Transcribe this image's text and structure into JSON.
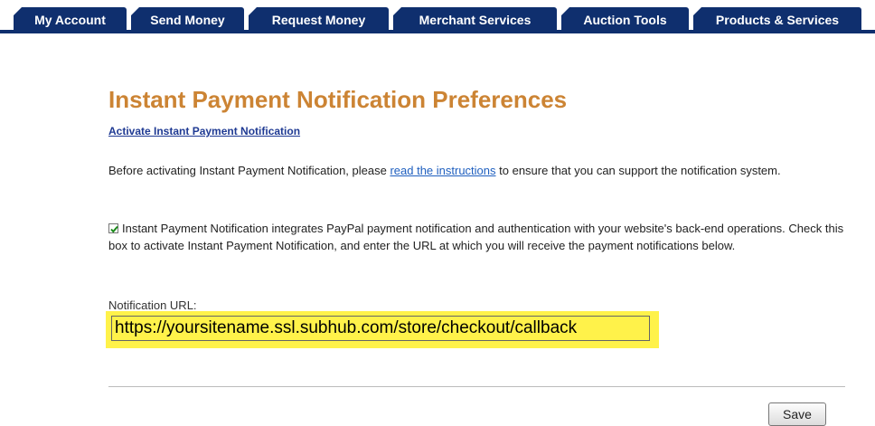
{
  "tabs": [
    {
      "label": "My Account"
    },
    {
      "label": "Send Money"
    },
    {
      "label": "Request Money"
    },
    {
      "label": "Merchant Services"
    },
    {
      "label": "Auction Tools"
    },
    {
      "label": "Products & Services"
    }
  ],
  "page": {
    "title": "Instant Payment Notification Preferences",
    "activate_link": "Activate Instant Payment Notification",
    "intro_before": "Before activating Instant Payment Notification, please ",
    "intro_link": "read the instructions",
    "intro_after": " to ensure that you can support the notification system.",
    "checkbox_checked": true,
    "checkbox_text": "Instant Payment Notification integrates PayPal payment notification and authentication with your website's back-end operations. Check this box to activate Instant Payment Notification, and enter the URL at which you will receive the payment notifications below.",
    "url_label": "Notification URL:",
    "url_value": "https://yoursitename.ssl.subhub.com/store/checkout/callback",
    "save_label": "Save"
  },
  "colors": {
    "tab_bg": "#0f2f6e",
    "title": "#cc8434",
    "highlight": "#fff24a",
    "link": "#1f5fbf"
  }
}
